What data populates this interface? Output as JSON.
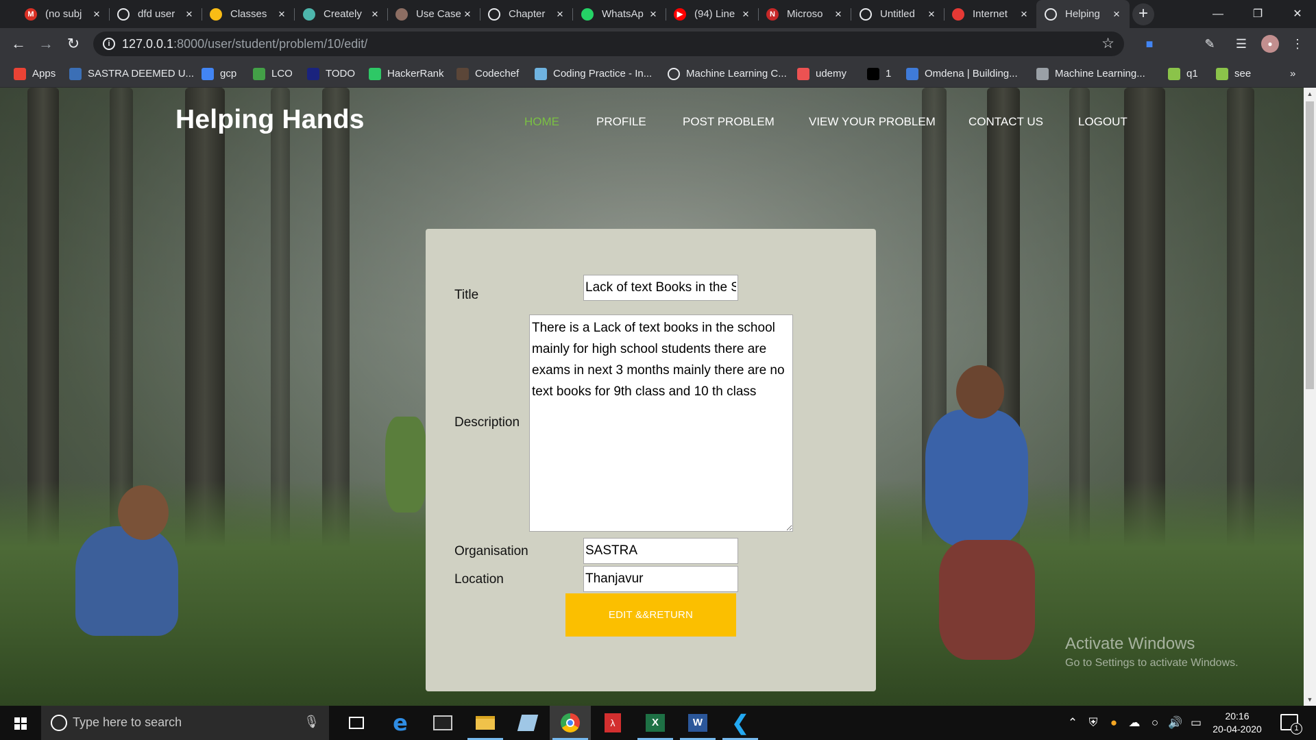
{
  "browser": {
    "tabs": [
      {
        "title": "(no subj",
        "icon": "gmail-icon",
        "color": "#d93025",
        "glyph": "M"
      },
      {
        "title": "dfd user",
        "icon": "globe-icon",
        "color": "#e8eaed",
        "glyph": ""
      },
      {
        "title": "Classes",
        "icon": "classroom-icon",
        "color": "#f9bc15",
        "glyph": ""
      },
      {
        "title": "Creately",
        "icon": "creately-icon",
        "color": "#4db6ac",
        "glyph": ""
      },
      {
        "title": "Use Case",
        "icon": "book-icon",
        "color": "#8d6e63",
        "glyph": ""
      },
      {
        "title": "Chapter",
        "icon": "globe-icon",
        "color": "#e8eaed",
        "glyph": ""
      },
      {
        "title": "WhatsAp",
        "icon": "whatsapp-icon",
        "color": "#25d366",
        "glyph": ""
      },
      {
        "title": "(94) Line",
        "icon": "youtube-icon",
        "color": "#ff0000",
        "glyph": "▶"
      },
      {
        "title": "Microso",
        "icon": "edx-icon",
        "color": "#c62828",
        "glyph": "N"
      },
      {
        "title": "Untitled",
        "icon": "globe-icon",
        "color": "#e8eaed",
        "glyph": ""
      },
      {
        "title": "Internet",
        "icon": "internet-icon",
        "color": "#e53935",
        "glyph": ""
      },
      {
        "title": "Helping",
        "icon": "globe-icon",
        "color": "#e8eaed",
        "glyph": "",
        "active": true
      }
    ],
    "url_host": "127.0.0.1",
    "url_path": ":8000/user/student/problem/10/edit/",
    "bookmarks": [
      {
        "label": "Apps",
        "icon": "apps-grid-icon",
        "color": "#ea4335"
      },
      {
        "label": "SASTRA DEEMED U...",
        "icon": "sastra-icon",
        "color": "#3b6fb6"
      },
      {
        "label": "gcp",
        "icon": "gcp-icon",
        "color": "#4285f4"
      },
      {
        "label": "LCO",
        "icon": "lco-icon",
        "color": "#43a047"
      },
      {
        "label": "TODO",
        "icon": "todo-icon",
        "color": "#1a237e"
      },
      {
        "label": "HackerRank",
        "icon": "hackerrank-icon",
        "color": "#2ec866"
      },
      {
        "label": "Codechef",
        "icon": "codechef-icon",
        "color": "#5b4638"
      },
      {
        "label": "Coding Practice - In...",
        "icon": "interviewbit-icon",
        "color": "#6fb3e0"
      },
      {
        "label": "Machine Learning C...",
        "icon": "globe-icon",
        "color": "#e8eaed"
      },
      {
        "label": "udemy",
        "icon": "udemy-icon",
        "color": "#ec5252"
      },
      {
        "label": "1",
        "icon": "medium-icon",
        "color": "#000000"
      },
      {
        "label": "Omdena | Building...",
        "icon": "omdena-icon",
        "color": "#3f7bd9"
      },
      {
        "label": "Machine Learning...",
        "icon": "ml-icon",
        "color": "#9aa0a6"
      },
      {
        "label": "q1",
        "icon": "colab-icon",
        "color": "#8bc34a"
      },
      {
        "label": "see",
        "icon": "colab-icon",
        "color": "#8bc34a"
      }
    ],
    "overflow": "»"
  },
  "site": {
    "brand": "Helping Hands",
    "nav": [
      {
        "label": "HOME",
        "active": true
      },
      {
        "label": "PROFILE"
      },
      {
        "label": "POST PROBLEM"
      },
      {
        "label": "VIEW YOUR PROBLEM"
      },
      {
        "label": "CONTACT US"
      },
      {
        "label": "LOGOUT"
      }
    ],
    "accent": "#7ac143"
  },
  "form": {
    "title_label": "Title",
    "title_value": "Lack of text Books in the S",
    "description_label": "Description",
    "description_value": "There is a Lack of text books in the school mainly for high school students there are exams in next 3 months mainly there are no text books for 9th class and 10 th class",
    "organisation_label": "Organisation",
    "organisation_value": "SASTRA",
    "location_label": "Location",
    "location_value": "Thanjavur",
    "submit_label": "EDIT &&RETURN",
    "button_color": "#fbbf00",
    "card_color": "#d0d1c3"
  },
  "watermark": {
    "line1": "Activate Windows",
    "line2": "Go to Settings to activate Windows."
  },
  "taskbar": {
    "search_placeholder": "Type here to search",
    "time": "20:16",
    "date": "20-04-2020",
    "notification_count": "1"
  }
}
